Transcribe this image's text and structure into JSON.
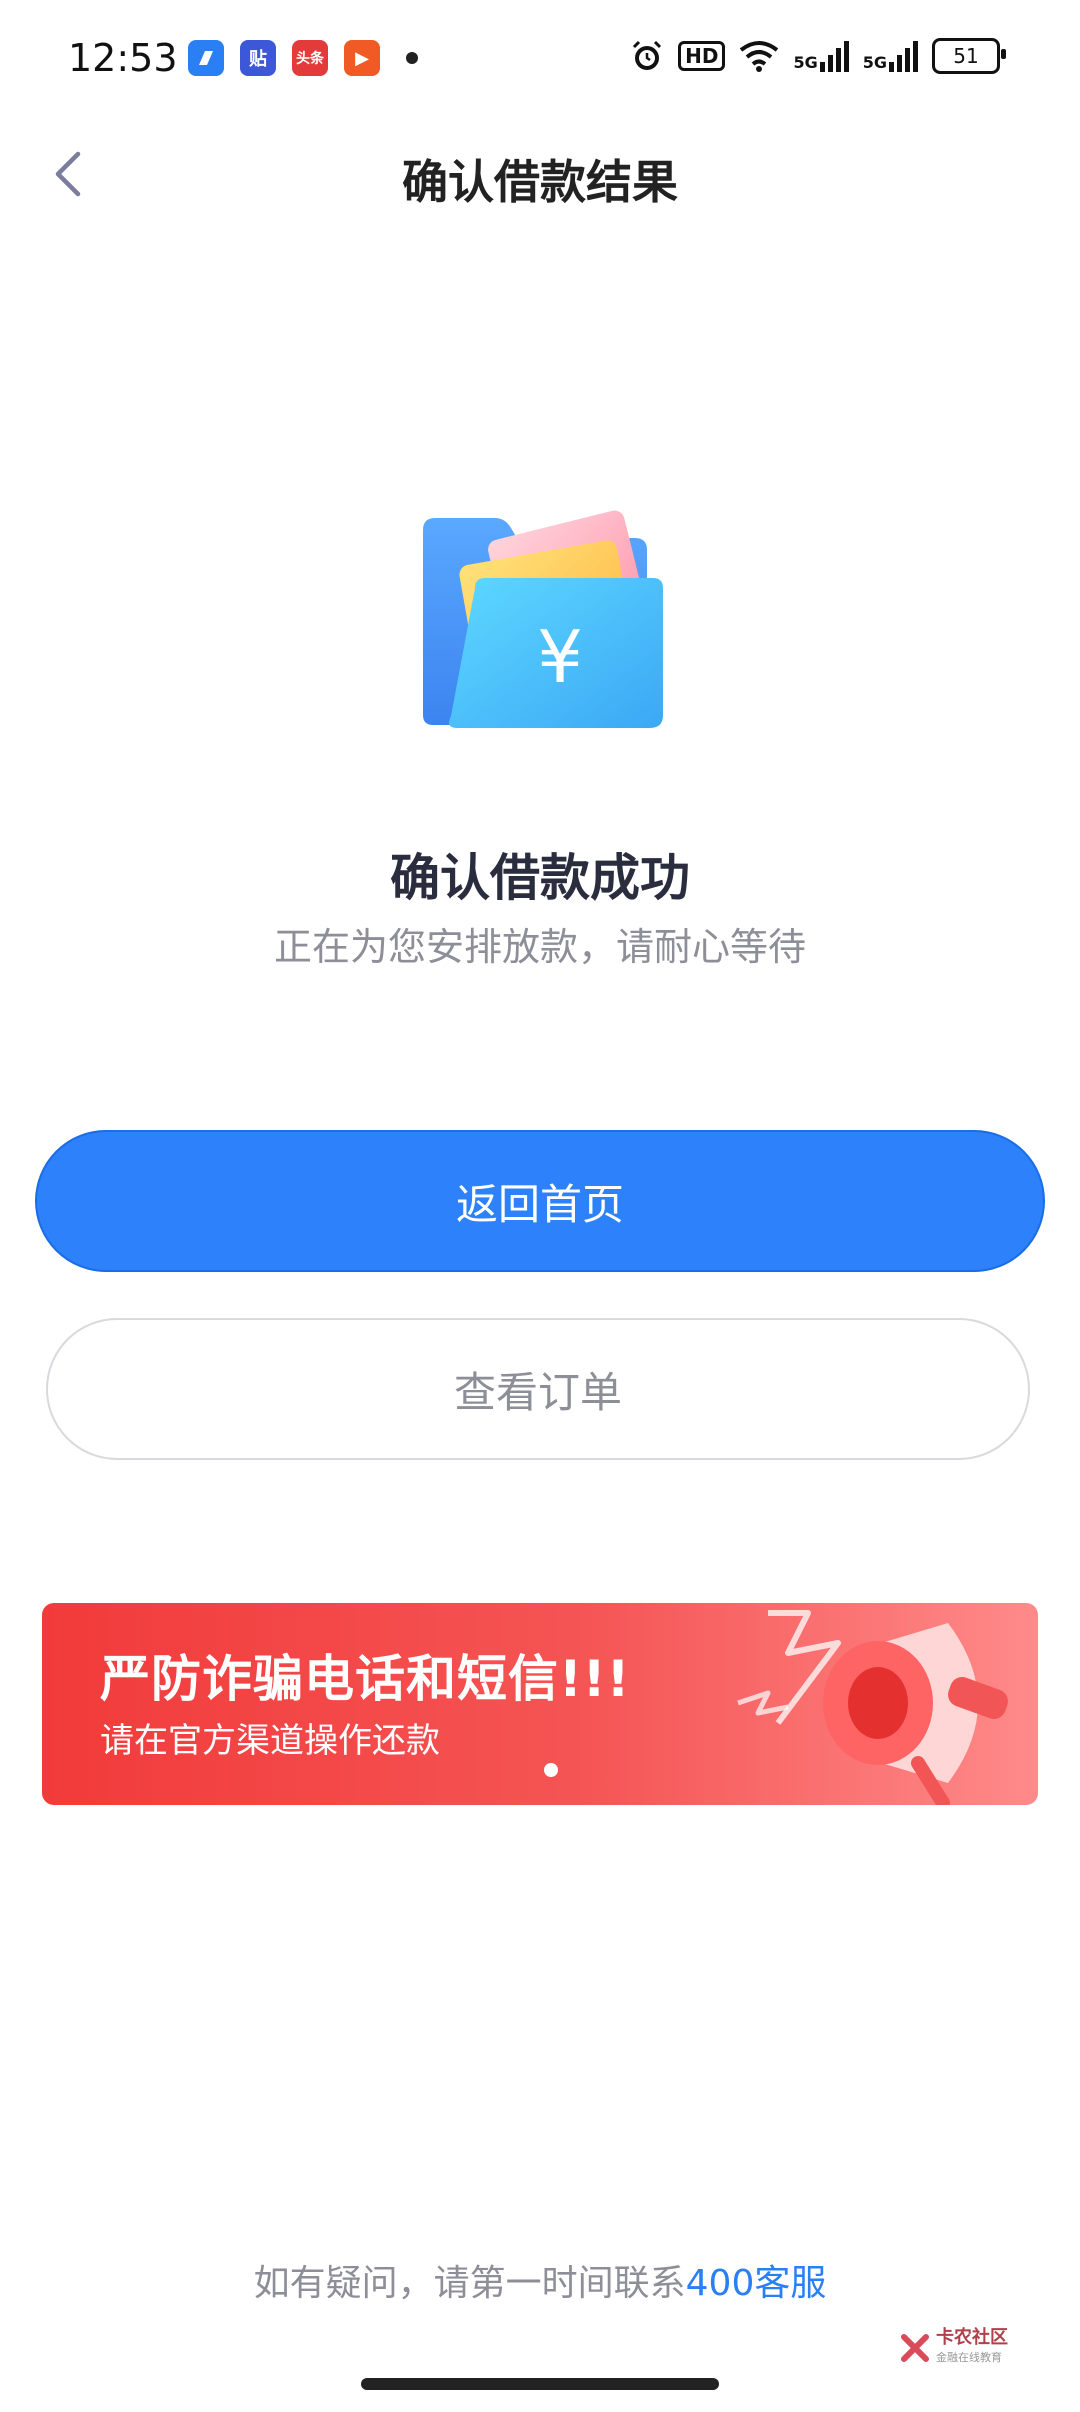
{
  "status_bar": {
    "time": "12:53",
    "notifications": [
      {
        "icon": "browser-app-icon",
        "label": ""
      },
      {
        "icon": "tieba-app-icon",
        "label": "贴"
      },
      {
        "icon": "toutiao-app-icon",
        "label": "头条"
      },
      {
        "icon": "video-app-icon",
        "label": "▶"
      }
    ],
    "hd_label": "HD",
    "network_1": "5G",
    "network_2": "5G",
    "battery": "51"
  },
  "header": {
    "title": "确认借款结果"
  },
  "result": {
    "title": "确认借款成功",
    "subtitle": "正在为您安排放款，请耐心等待",
    "currency_symbol": "¥"
  },
  "actions": {
    "primary_label": "返回首页",
    "secondary_label": "查看订单"
  },
  "banner": {
    "title": "严防诈骗电话和短信!!!",
    "subtitle": "请在官方渠道操作还款"
  },
  "footer": {
    "help_text": "如有疑问，请第一时间联系",
    "help_link": "400客服",
    "watermark_title": "卡农社区",
    "watermark_sub": "金融在线教育"
  },
  "colors": {
    "primary": "#2d82fb",
    "banner_red": "#f23a3a",
    "link": "#2a7ff5",
    "muted": "#8e8e98"
  }
}
